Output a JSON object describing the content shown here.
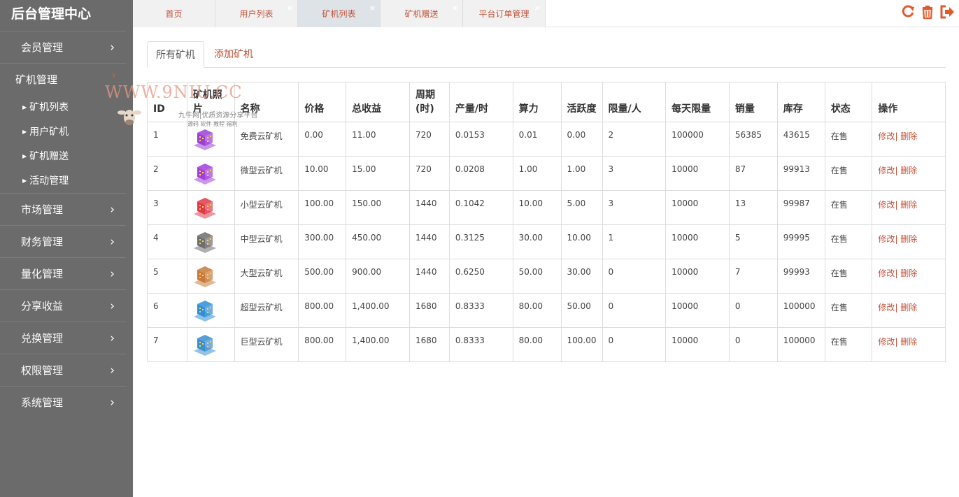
{
  "sidebar": {
    "title": "后台管理中心",
    "menu": [
      {
        "label": "会员管理"
      },
      {
        "label": "矿机管理",
        "children": [
          "矿机列表",
          "用户矿机",
          "矿机赠送",
          "活动管理"
        ]
      },
      {
        "label": "市场管理"
      },
      {
        "label": "财务管理"
      },
      {
        "label": "量化管理"
      },
      {
        "label": "分享收益"
      },
      {
        "label": "兑换管理"
      },
      {
        "label": "权限管理"
      },
      {
        "label": "系统管理"
      }
    ]
  },
  "tabs": [
    {
      "label": "首页",
      "closable": false,
      "active": false
    },
    {
      "label": "用户列表",
      "closable": true,
      "active": false
    },
    {
      "label": "矿机列表",
      "closable": true,
      "active": true
    },
    {
      "label": "矿机赠送",
      "closable": true,
      "active": false
    },
    {
      "label": "平台订单管理",
      "closable": true,
      "active": false
    }
  ],
  "top_icons": [
    "refresh-icon",
    "trash-icon",
    "logout-icon"
  ],
  "subtabs": {
    "all": "所有矿机",
    "add": "添加矿机"
  },
  "watermark": {
    "main": "WWW.9NIU.CC",
    "line2": "九牛网|优质资源分享平台",
    "line3": "源码 软件 教程 福利"
  },
  "table": {
    "headers": [
      "ID",
      "矿机照片",
      "名称",
      "价格",
      "总收益",
      "周期(时)",
      "产量/时",
      "算力",
      "活跃度",
      "限量/人",
      "每天限量",
      "销量",
      "库存",
      "状态",
      "操作"
    ],
    "rows": [
      {
        "id": "1",
        "img_color": "#9b3fd6",
        "name": "免费云矿机",
        "price": "0.00",
        "total": "11.00",
        "cycle": "720",
        "output": "0.0153",
        "power": "0.01",
        "active": "0.00",
        "limit": "2",
        "daily": "100000",
        "sales": "56385",
        "stock": "43615",
        "status": "在售"
      },
      {
        "id": "2",
        "img_color": "#a23fd8",
        "name": "微型云矿机",
        "price": "10.00",
        "total": "15.00",
        "cycle": "720",
        "output": "0.0208",
        "power": "1.00",
        "active": "1.00",
        "limit": "3",
        "daily": "10000",
        "sales": "87",
        "stock": "99913",
        "status": "在售"
      },
      {
        "id": "3",
        "img_color": "#e03a4a",
        "name": "小型云矿机",
        "price": "100.00",
        "total": "150.00",
        "cycle": "1440",
        "output": "0.1042",
        "power": "10.00",
        "active": "5.00",
        "limit": "3",
        "daily": "10000",
        "sales": "13",
        "stock": "99987",
        "status": "在售"
      },
      {
        "id": "4",
        "img_color": "#6e6e6e",
        "name": "中型云矿机",
        "price": "300.00",
        "total": "450.00",
        "cycle": "1440",
        "output": "0.3125",
        "power": "30.00",
        "active": "10.00",
        "limit": "1",
        "daily": "10000",
        "sales": "5",
        "stock": "99995",
        "status": "在售"
      },
      {
        "id": "5",
        "img_color": "#c87a3a",
        "name": "大型云矿机",
        "price": "500.00",
        "total": "900.00",
        "cycle": "1440",
        "output": "0.6250",
        "power": "50.00",
        "active": "30.00",
        "limit": "0",
        "daily": "10000",
        "sales": "7",
        "stock": "99993",
        "status": "在售"
      },
      {
        "id": "6",
        "img_color": "#2e8fd8",
        "name": "超型云矿机",
        "price": "800.00",
        "total": "1,400.00",
        "cycle": "1680",
        "output": "0.8333",
        "power": "80.00",
        "active": "50.00",
        "limit": "0",
        "daily": "10000",
        "sales": "0",
        "stock": "100000",
        "status": "在售"
      },
      {
        "id": "7",
        "img_color": "#3a8fd0",
        "name": "巨型云矿机",
        "price": "800.00",
        "total": "1,400.00",
        "cycle": "1680",
        "output": "0.8333",
        "power": "80.00",
        "active": "100.00",
        "limit": "0",
        "daily": "10000",
        "sales": "0",
        "stock": "100000",
        "status": "在售"
      }
    ],
    "edit_label": "修改",
    "sep": "|",
    "delete_label": " 删除"
  }
}
